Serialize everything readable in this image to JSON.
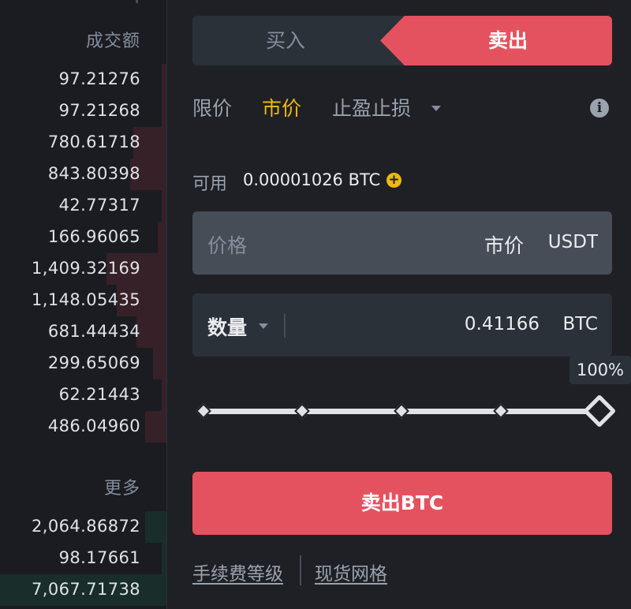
{
  "order_book": {
    "header": "成交额",
    "more_label": "更多",
    "sell_rows": [
      {
        "value": "97.21276",
        "depth": 0.03
      },
      {
        "value": "97.21268",
        "depth": 0.03
      },
      {
        "value": "780.61718",
        "depth": 0.2
      },
      {
        "value": "843.80398",
        "depth": 0.22
      },
      {
        "value": "42.77317",
        "depth": 0.03
      },
      {
        "value": "166.96065",
        "depth": 0.05
      },
      {
        "value": "1,409.32169",
        "depth": 0.36
      },
      {
        "value": "1,148.05435",
        "depth": 0.3
      },
      {
        "value": "681.44434",
        "depth": 0.18
      },
      {
        "value": "299.65069",
        "depth": 0.08
      },
      {
        "value": "62.21443",
        "depth": 0.03
      },
      {
        "value": "486.04960",
        "depth": 0.13
      }
    ],
    "buy_rows": [
      {
        "value": "2,064.86872",
        "depth": 0.13
      },
      {
        "value": "98.17661",
        "depth": 0.03
      },
      {
        "value": "7,067.71738",
        "depth": 1.0
      }
    ]
  },
  "trade": {
    "tab_buy": "买入",
    "tab_sell": "卖出",
    "order_types": {
      "limit": "限价",
      "market": "市价",
      "stop": "止盈止损"
    },
    "available_label": "可用",
    "available_value": "0.00001026 BTC",
    "price_label": "价格",
    "price_value": "市价",
    "price_unit": "USDT",
    "qty_label": "数量",
    "qty_value": "0.41166",
    "qty_unit": "BTC",
    "slider_percent_label": "100%",
    "slider_percent": 100,
    "sell_button": "卖出BTC",
    "fee_link": "手续费等级",
    "grid_link": "现货网格"
  },
  "colors": {
    "sell_accent": "#e5525f",
    "market_active": "#f0b90b",
    "background": "#1e2026"
  },
  "icons": [
    "chevron-down-icon",
    "info-icon",
    "plus-circle-icon",
    "slider-handle-icon"
  ]
}
